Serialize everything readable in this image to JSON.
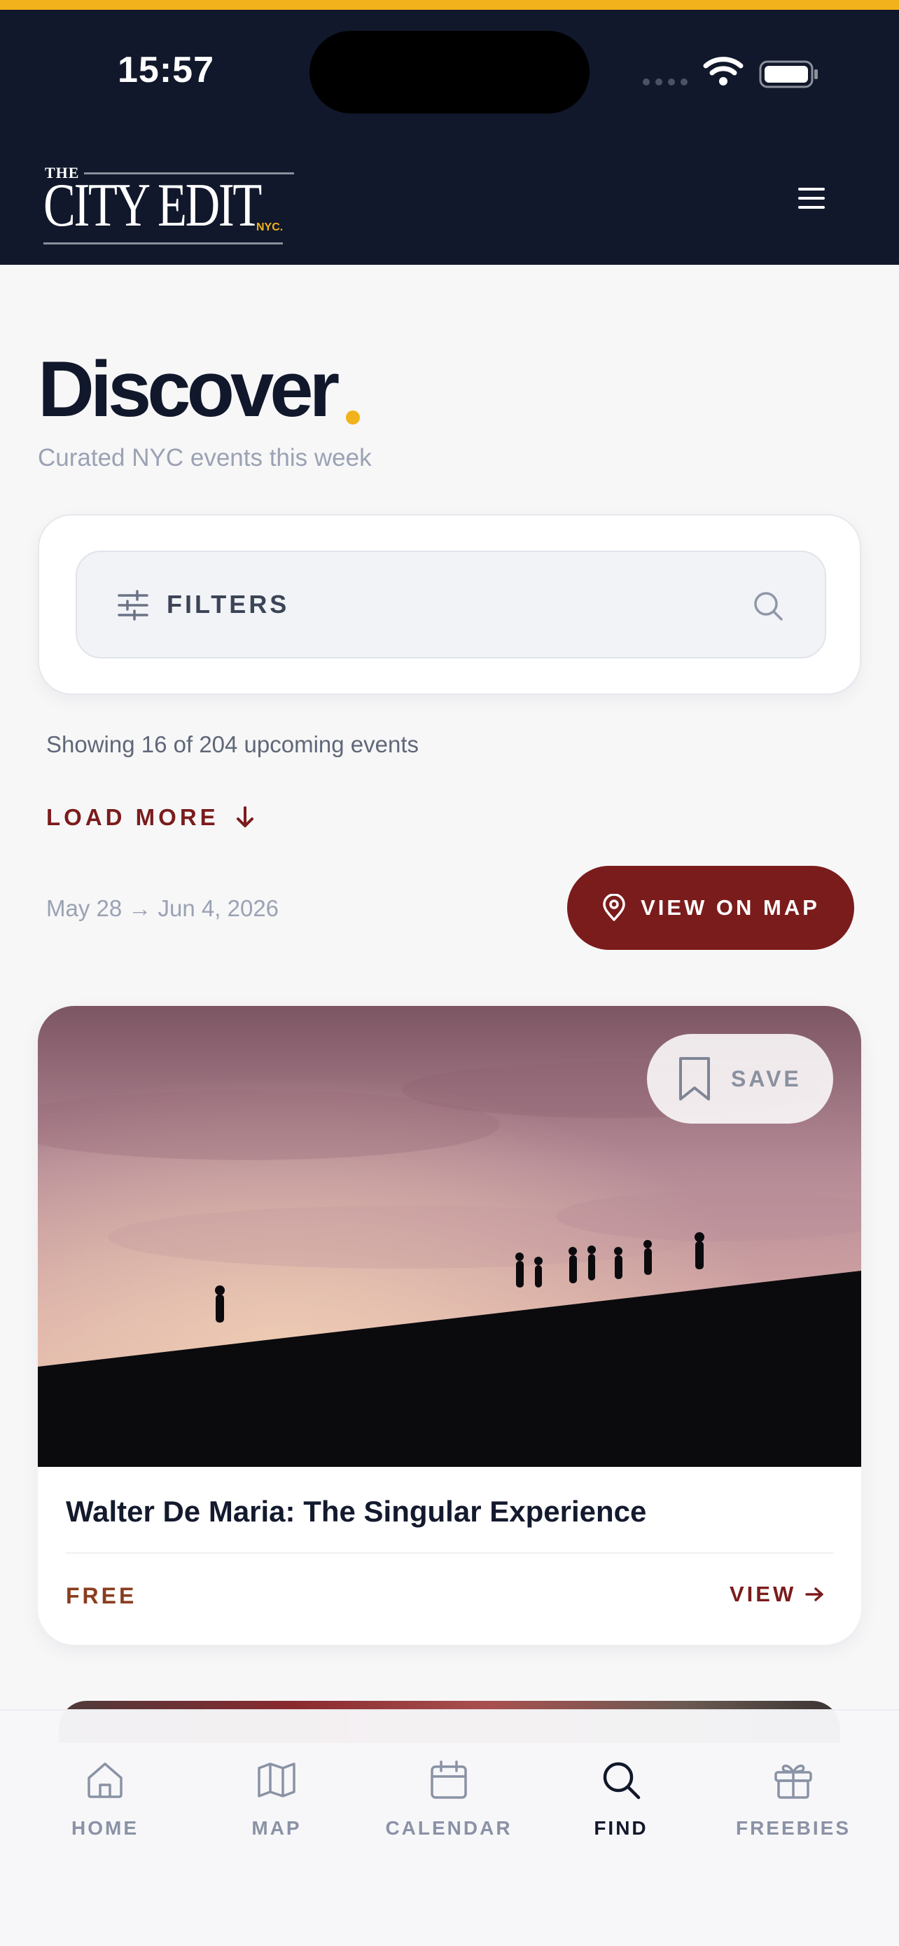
{
  "status_bar": {
    "time": "15:57"
  },
  "header": {
    "logo": {
      "the": "THE",
      "name": "CITY EDIT",
      "suffix": "NYC."
    },
    "menu_icon": "hamburger-menu-icon"
  },
  "hero": {
    "title": "Discover",
    "subtitle": "Curated NYC events this week"
  },
  "filters": {
    "label": "FILTERS",
    "icons": [
      "sliders-icon",
      "search-icon"
    ]
  },
  "results": {
    "summary": "Showing 16 of 204 upcoming events",
    "load_more": "LOAD MORE"
  },
  "date_range": "May 28 → Jun 4, 2026",
  "map_button": {
    "label": "VIEW ON MAP"
  },
  "events": [
    {
      "title": "Walter De Maria: The Singular Experience",
      "price": "FREE",
      "save_label": "SAVE",
      "view_label": "VIEW"
    }
  ],
  "bottom_nav": [
    {
      "label": "HOME",
      "icon": "home-icon",
      "active": false
    },
    {
      "label": "MAP",
      "icon": "map-icon",
      "active": false
    },
    {
      "label": "CALENDAR",
      "icon": "calendar-icon",
      "active": false
    },
    {
      "label": "FIND",
      "icon": "search-icon",
      "active": true
    },
    {
      "label": "FREEBIES",
      "icon": "gift-icon",
      "active": false
    }
  ],
  "colors": {
    "header_bg": "#11182b",
    "accent_gold": "#f2b21b",
    "brand_red": "#7b1c1c",
    "price_brown": "#8a3d1e",
    "page_bg": "#f7f7f8"
  }
}
